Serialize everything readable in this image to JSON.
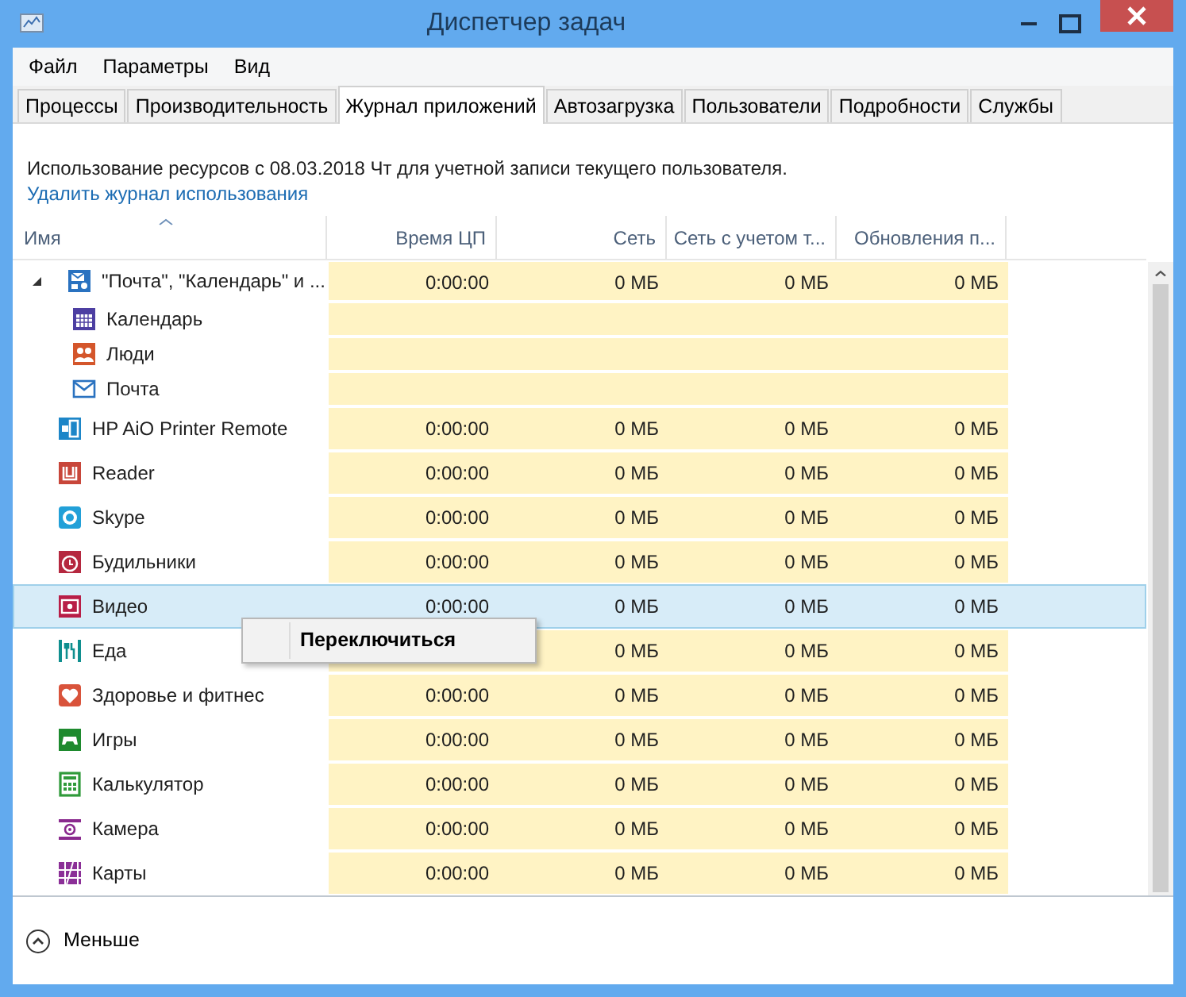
{
  "window": {
    "title": "Диспетчер задач"
  },
  "menu": [
    "Файл",
    "Параметры",
    "Вид"
  ],
  "tabs": [
    {
      "label": "Процессы",
      "selected": false
    },
    {
      "label": "Производительность",
      "selected": false
    },
    {
      "label": "Журнал приложений",
      "selected": true
    },
    {
      "label": "Автозагрузка",
      "selected": false
    },
    {
      "label": "Пользователи",
      "selected": false
    },
    {
      "label": "Подробности",
      "selected": false
    },
    {
      "label": "Службы",
      "selected": false
    }
  ],
  "summary": "Использование ресурсов с 08.03.2018 Чт для учетной записи текущего пользователя.",
  "clear_link": "Удалить журнал использования",
  "columns": [
    {
      "label": "Имя",
      "sorted": true
    },
    {
      "label": "Время ЦП",
      "sorted": false
    },
    {
      "label": "Сеть",
      "sorted": false
    },
    {
      "label": "Сеть с учетом т...",
      "sorted": false
    },
    {
      "label": "Обновления п...",
      "sorted": false
    }
  ],
  "rows": [
    {
      "name": "\"Почта\", \"Календарь\" и ...",
      "cpu": "0:00:00",
      "network": "0 МБ",
      "metered": "0 МБ",
      "updates": "0 МБ",
      "selected": false,
      "expanded": true,
      "children": [
        {
          "name": "Календарь",
          "selected": false
        },
        {
          "name": "Люди",
          "selected": false
        },
        {
          "name": "Почта",
          "selected": false
        }
      ]
    },
    {
      "name": "HP AiO Printer Remote",
      "cpu": "0:00:00",
      "network": "0 МБ",
      "metered": "0 МБ",
      "updates": "0 МБ",
      "selected": false
    },
    {
      "name": "Reader",
      "cpu": "0:00:00",
      "network": "0 МБ",
      "metered": "0 МБ",
      "updates": "0 МБ",
      "selected": false
    },
    {
      "name": "Skype",
      "cpu": "0:00:00",
      "network": "0 МБ",
      "metered": "0 МБ",
      "updates": "0 МБ",
      "selected": false
    },
    {
      "name": "Будильники",
      "cpu": "0:00:00",
      "network": "0 МБ",
      "metered": "0 МБ",
      "updates": "0 МБ",
      "selected": false
    },
    {
      "name": "Видео",
      "cpu": "0:00:00",
      "network": "0 МБ",
      "metered": "0 МБ",
      "updates": "0 МБ",
      "selected": true
    },
    {
      "name": "Еда",
      "network": "0 МБ",
      "metered": "0 МБ",
      "updates": "0 МБ",
      "selected": false
    },
    {
      "name": "Здоровье и фитнес",
      "cpu": "0:00:00",
      "network": "0 МБ",
      "metered": "0 МБ",
      "updates": "0 МБ",
      "selected": false
    },
    {
      "name": "Игры",
      "cpu": "0:00:00",
      "network": "0 МБ",
      "metered": "0 МБ",
      "updates": "0 МБ",
      "selected": false
    },
    {
      "name": "Калькулятор",
      "cpu": "0:00:00",
      "network": "0 МБ",
      "metered": "0 МБ",
      "updates": "0 МБ",
      "selected": false
    },
    {
      "name": "Камера",
      "cpu": "0:00:00",
      "network": "0 МБ",
      "metered": "0 МБ",
      "updates": "0 МБ",
      "selected": false
    },
    {
      "name": "Карты",
      "cpu": "0:00:00",
      "network": "0 МБ",
      "metered": "0 МБ",
      "updates": "0 МБ",
      "selected": false
    }
  ],
  "context_menu": {
    "items": [
      "Переключиться"
    ]
  },
  "footer": {
    "label": "Меньше"
  }
}
